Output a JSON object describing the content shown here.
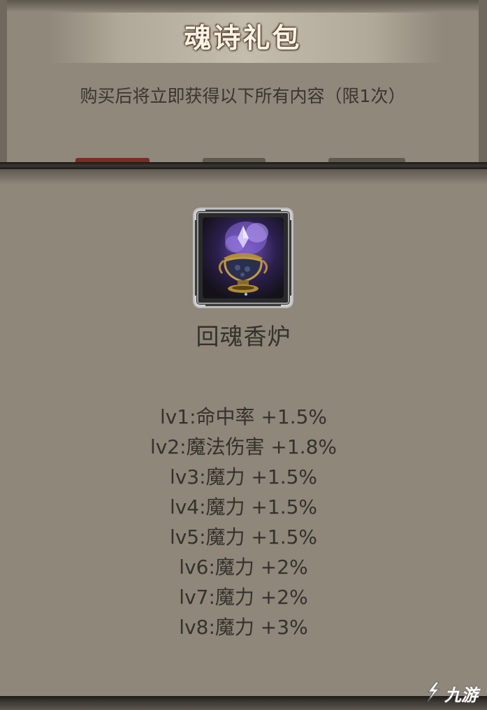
{
  "popup": {
    "title": "魂诗礼包",
    "subtitle": "购买后将立即获得以下所有内容（限1次）"
  },
  "item": {
    "icon": "incense-burner-icon",
    "name": "回魂香炉",
    "stats": [
      "lv1:命中率 +1.5%",
      "lv2:魔法伤害 +1.8%",
      "lv3:魔力 +1.5%",
      "lv4:魔力 +1.5%",
      "lv5:魔力 +1.5%",
      "lv6:魔力 +2%",
      "lv7:魔力 +2%",
      "lv8:魔力 +3%"
    ]
  },
  "watermark": {
    "logo": "jiuyou-logo-icon",
    "text": "九游"
  },
  "colors": {
    "panel_bg": "#8e877a",
    "text_dark": "#35312c",
    "title_text": "#fbf3e6",
    "divider": "#1a1917"
  }
}
